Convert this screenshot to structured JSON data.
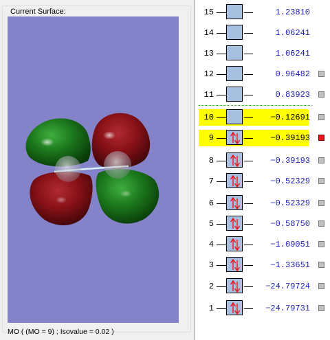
{
  "surface_panel": {
    "title": "Current Surface:",
    "status": "MO ( (MO = 9) ; Isovalue = 0.02 )",
    "background_color": "#8482c9",
    "lobe_colors": {
      "positive": "#1d7a1d",
      "negative": "#8a1218"
    }
  },
  "orbitals": [
    {
      "number": "15",
      "energy": "1.23810",
      "occupied": false,
      "highlighted": false,
      "has_selector": false,
      "selector_active": false
    },
    {
      "number": "14",
      "energy": "1.06241",
      "occupied": false,
      "highlighted": false,
      "has_selector": false,
      "selector_active": false
    },
    {
      "number": "13",
      "energy": "1.06241",
      "occupied": false,
      "highlighted": false,
      "has_selector": false,
      "selector_active": false
    },
    {
      "number": "12",
      "energy": "0.96482",
      "occupied": false,
      "highlighted": false,
      "has_selector": true,
      "selector_active": false
    },
    {
      "number": "11",
      "energy": "0.83923",
      "occupied": false,
      "highlighted": false,
      "has_selector": true,
      "selector_active": false
    },
    {
      "number": "10",
      "energy": "−0.12691",
      "occupied": false,
      "highlighted": true,
      "has_selector": true,
      "selector_active": false
    },
    {
      "number": "9",
      "energy": "−0.39193",
      "occupied": true,
      "highlighted": true,
      "has_selector": true,
      "selector_active": true
    },
    {
      "number": "8",
      "energy": "−0.39193",
      "occupied": true,
      "highlighted": false,
      "has_selector": true,
      "selector_active": false
    },
    {
      "number": "7",
      "energy": "−0.52329",
      "occupied": true,
      "highlighted": false,
      "has_selector": true,
      "selector_active": false
    },
    {
      "number": "6",
      "energy": "−0.52329",
      "occupied": true,
      "highlighted": false,
      "has_selector": true,
      "selector_active": false
    },
    {
      "number": "5",
      "energy": "−0.58750",
      "occupied": true,
      "highlighted": false,
      "has_selector": true,
      "selector_active": false
    },
    {
      "number": "4",
      "energy": "−1.09051",
      "occupied": true,
      "highlighted": false,
      "has_selector": true,
      "selector_active": false
    },
    {
      "number": "3",
      "energy": "−1.33651",
      "occupied": true,
      "highlighted": false,
      "has_selector": true,
      "selector_active": false
    },
    {
      "number": "2",
      "energy": "−24.79724",
      "occupied": true,
      "highlighted": false,
      "has_selector": true,
      "selector_active": false
    },
    {
      "number": "1",
      "energy": "−24.79731",
      "occupied": true,
      "highlighted": false,
      "has_selector": true,
      "selector_active": false
    }
  ],
  "colors": {
    "level_box": "#a7c0e0",
    "energy_text": "#1c1cb8",
    "highlight": "#ffff00",
    "electron_arrows": "#e8141c",
    "homo_lumo_divider": "#1db31d",
    "selector_active": "#e8141c",
    "selector_inactive": "#c0c0c0"
  }
}
